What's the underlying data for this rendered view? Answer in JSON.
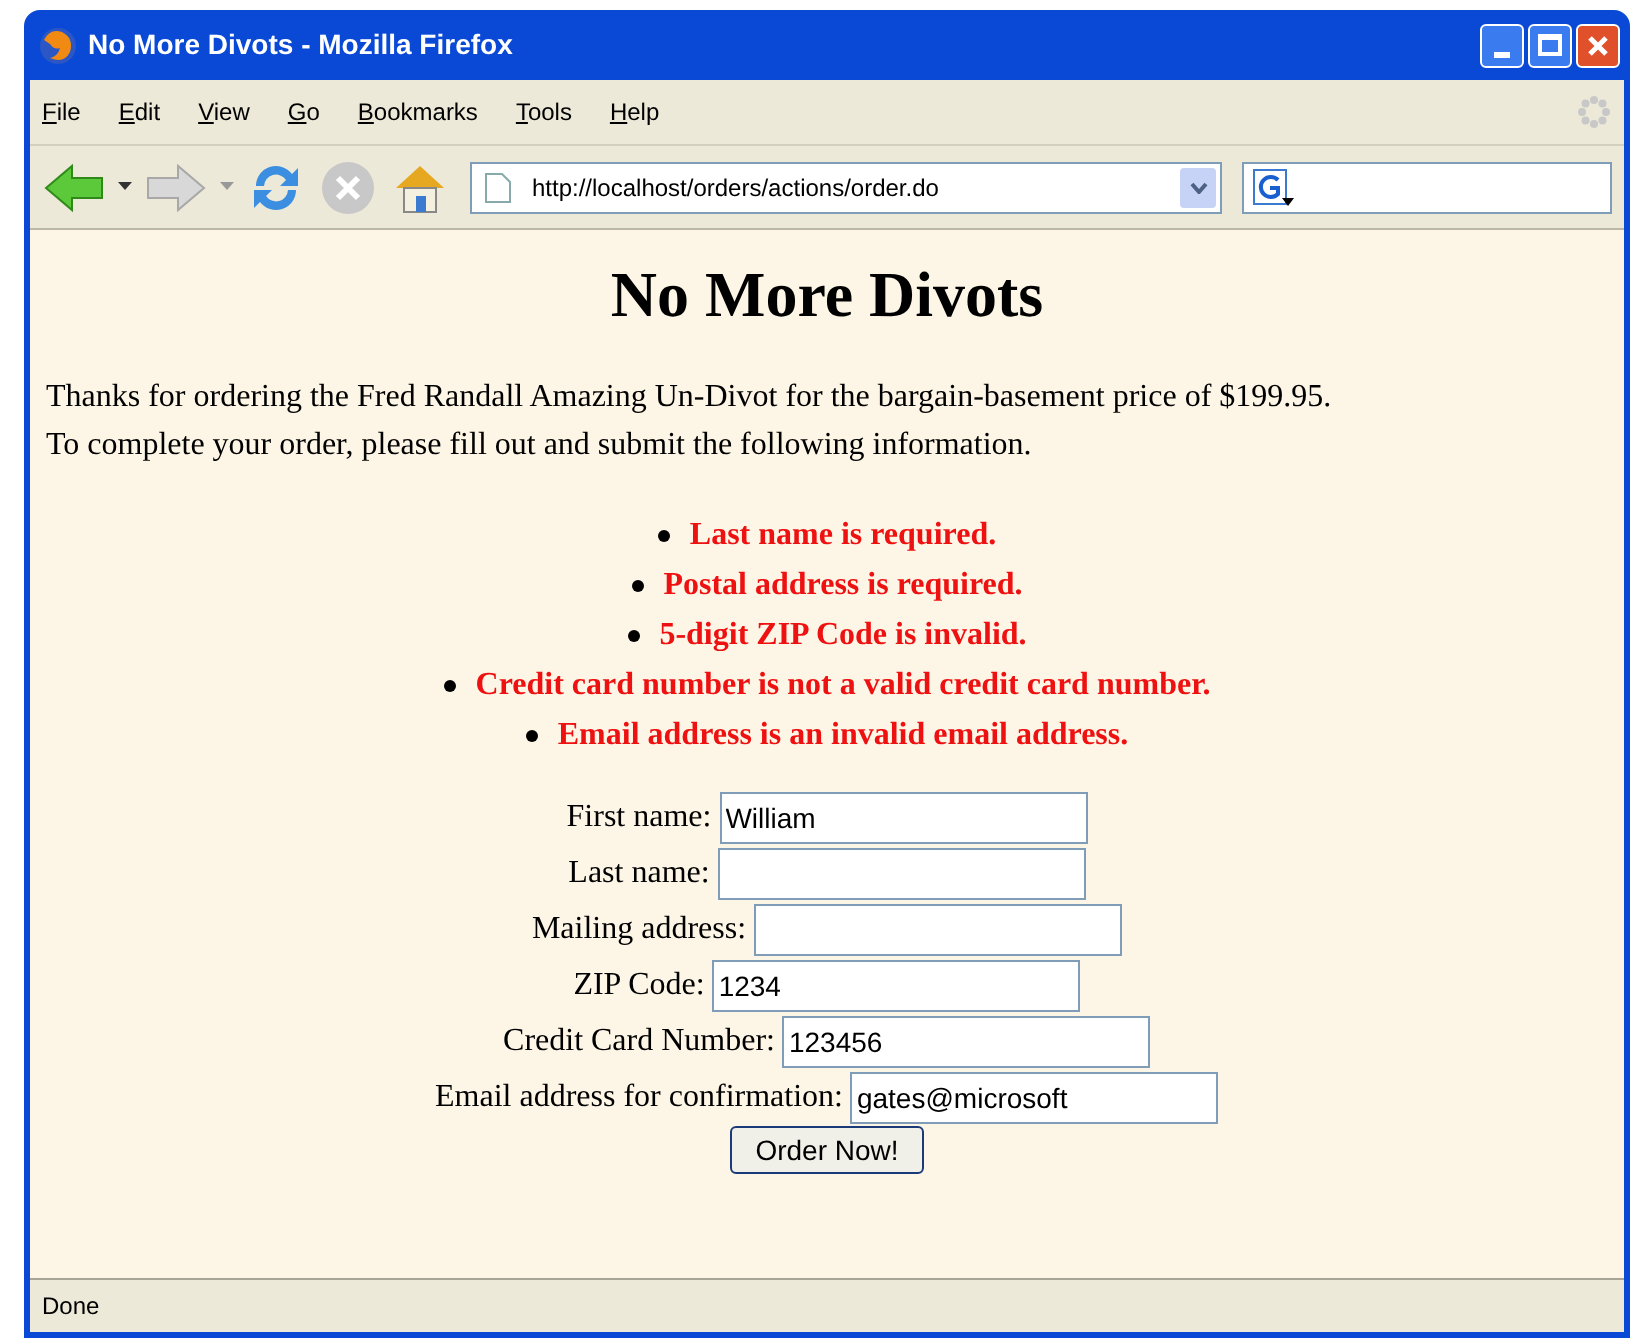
{
  "window": {
    "title": "No More Divots - Mozilla Firefox"
  },
  "menu": [
    "File",
    "Edit",
    "View",
    "Go",
    "Bookmarks",
    "Tools",
    "Help"
  ],
  "address_bar": {
    "value": "http://localhost/orders/actions/order.do"
  },
  "page": {
    "heading": "No More Divots",
    "intro": [
      "Thanks for ordering the Fred Randall Amazing Un-Divot for the bargain-basement price of $199.95.",
      "To complete your order, please fill out and submit the following information."
    ],
    "errors": [
      "Last name is required.",
      "Postal address is required.",
      "5-digit ZIP Code is invalid.",
      "Credit card number is not a valid credit card number.",
      "Email address is an invalid email address."
    ],
    "fields": [
      {
        "label": "First name:",
        "value": "William"
      },
      {
        "label": "Last name:"
      },
      {
        "label": "Mailing address:"
      },
      {
        "label": "ZIP Code:",
        "value": "1234"
      },
      {
        "label": "Credit Card Number:",
        "value": "123456"
      },
      {
        "label": "Email address for confirmation:",
        "value": "gates@microsoft"
      }
    ],
    "submit": "Order Now!"
  },
  "status_bar": {
    "text": "Done"
  }
}
